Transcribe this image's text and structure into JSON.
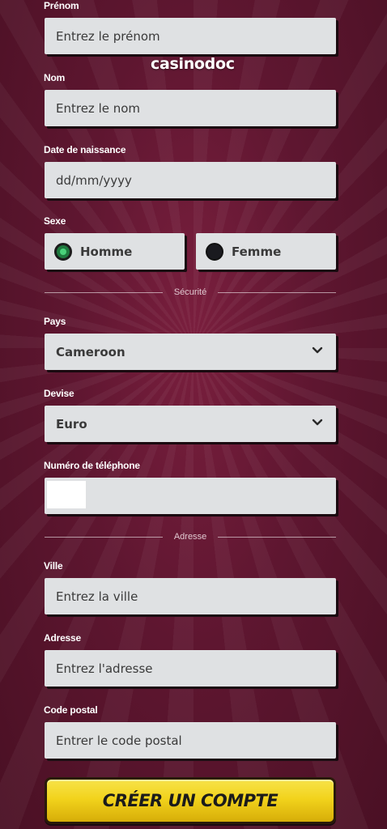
{
  "logo": "casinodoc",
  "fields": {
    "prenom": {
      "label": "Prénom",
      "placeholder": "Entrez le prénom"
    },
    "nom": {
      "label": "Nom",
      "placeholder": "Entrez le nom"
    },
    "naissance": {
      "label": "Date de naissance",
      "placeholder": "dd/mm/yyyy"
    },
    "sexe": {
      "label": "Sexe",
      "options": [
        "Homme",
        "Femme"
      ],
      "selected": "Homme"
    },
    "pays": {
      "label": "Pays",
      "value": "Cameroon"
    },
    "devise": {
      "label": "Devise",
      "value": "Euro"
    },
    "telephone": {
      "label": "Numéro de téléphone",
      "value": ""
    },
    "ville": {
      "label": "Ville",
      "placeholder": "Entrez la ville"
    },
    "adresse": {
      "label": "Adresse",
      "placeholder": "Entrez l'adresse"
    },
    "code_postal": {
      "label": "Code postal",
      "placeholder": "Entrer le code postal"
    }
  },
  "sections": {
    "securite": "Sécurité",
    "adresse": "Adresse"
  },
  "submit_label": "CRÉER UN COMPTE",
  "colors": {
    "background": "#5e1630",
    "field": "#dfe1e3",
    "cta": "#f2d31c",
    "radio_selected": "#1f7a3f"
  },
  "icons": {
    "select": "chevron-down-icon",
    "radio_selected": "radio-checked-icon",
    "radio_unselected": "radio-unchecked-icon"
  }
}
